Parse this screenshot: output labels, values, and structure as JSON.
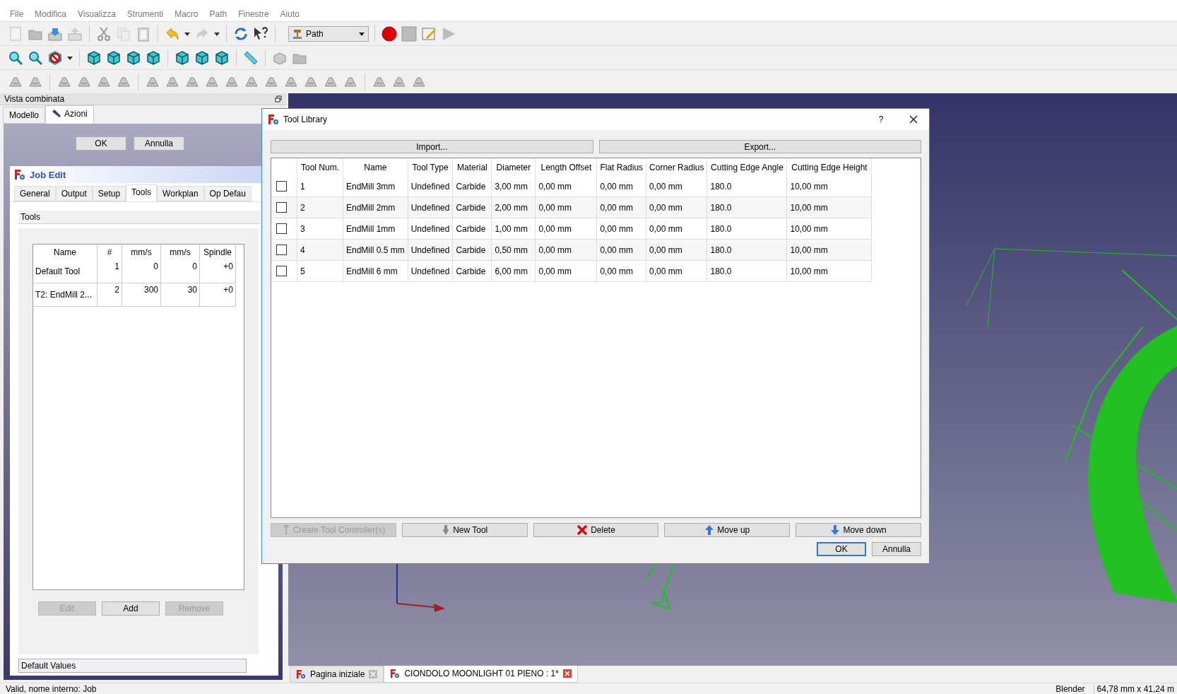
{
  "menu": [
    "File",
    "Modifica",
    "Visualizza",
    "Strumenti",
    "Macro",
    "Path",
    "Finestre",
    "Aiuto"
  ],
  "workbench": {
    "value": "Path"
  },
  "combo_view": {
    "title": "Vista combinata",
    "tabs": [
      {
        "label": "Modello",
        "selected": false
      },
      {
        "label": "Azioni",
        "selected": true
      }
    ],
    "buttons": [
      "OK",
      "Annulla"
    ]
  },
  "job_edit": {
    "title": "Job Edit",
    "tabs": [
      {
        "label": "General",
        "selected": false
      },
      {
        "label": "Output",
        "selected": false
      },
      {
        "label": "Setup",
        "selected": false
      },
      {
        "label": "Tools",
        "selected": true
      },
      {
        "label": "Workplan",
        "selected": false
      },
      {
        "label": "Op Defau",
        "selected": false
      }
    ],
    "group": "Tools",
    "columns": [
      "Name",
      "#",
      "mm/s",
      "mm/s",
      "Spindle"
    ],
    "rows": [
      [
        "Default Tool",
        "1",
        "0",
        "0",
        "+0"
      ],
      [
        "T2: EndMill 2...",
        "2",
        "300",
        "30",
        "+0"
      ]
    ],
    "buttons": [
      {
        "label": "Edit",
        "disabled": true
      },
      {
        "label": "Add",
        "disabled": false
      },
      {
        "label": "Remove",
        "disabled": true
      }
    ],
    "section": "Default Values"
  },
  "tool_library": {
    "title": "Tool Library",
    "help": "?",
    "import": "Import...",
    "export": "Export...",
    "columns": [
      "Tool Num.",
      "Name",
      "Tool Type",
      "Material",
      "Diameter",
      "Length Offset",
      "Flat Radius",
      "Corner Radius",
      "Cutting Edge Angle",
      "Cutting Edge Height"
    ],
    "rows": [
      {
        "checked": false,
        "cells": [
          "1",
          "EndMill 3mm",
          "Undefined",
          "Carbide",
          "3,00 mm",
          "0,00 mm",
          "0,00 mm",
          "0,00 mm",
          "180.0",
          "10,00 mm"
        ]
      },
      {
        "checked": false,
        "cells": [
          "2",
          "EndMill 2mm",
          "Undefined",
          "Carbide",
          "2,00 mm",
          "0,00 mm",
          "0,00 mm",
          "0,00 mm",
          "180.0",
          "10,00 mm"
        ]
      },
      {
        "checked": false,
        "cells": [
          "3",
          "EndMill 1mm",
          "Undefined",
          "Carbide",
          "1,00 mm",
          "0,00 mm",
          "0,00 mm",
          "0,00 mm",
          "180.0",
          "10,00 mm"
        ]
      },
      {
        "checked": false,
        "cells": [
          "4",
          "EndMill 0.5 mm",
          "Undefined",
          "Carbide",
          "0,50 mm",
          "0,00 mm",
          "0,00 mm",
          "0,00 mm",
          "180.0",
          "10,00 mm"
        ]
      },
      {
        "checked": false,
        "cells": [
          "5",
          "EndMill 6 mm",
          "Undefined",
          "Carbide",
          "6,00 mm",
          "0,00 mm",
          "0,00 mm",
          "0,00 mm",
          "180.0",
          "10,00 mm"
        ]
      }
    ],
    "actions": [
      {
        "kind": "controller",
        "label": "Create Tool Controller(s)",
        "disabled": true
      },
      {
        "kind": "new",
        "label": "New Tool",
        "disabled": false
      },
      {
        "kind": "delete",
        "label": "Delete",
        "disabled": false
      },
      {
        "kind": "up",
        "label": "Move up",
        "disabled": false
      },
      {
        "kind": "down",
        "label": "Move down",
        "disabled": false
      }
    ],
    "ok": "OK",
    "cancel": "Annulla"
  },
  "document_tabs": [
    {
      "label": "Pagina iniziale",
      "selected": false
    },
    {
      "label": "CIONDOLO MOONLIGHT 01 PIENO : 1*",
      "selected": true
    }
  ],
  "status_bar": {
    "message": "Valid, nome interno: Job",
    "navigation": "Blender",
    "dimensions": "64,78 mm x 41,24 m"
  }
}
